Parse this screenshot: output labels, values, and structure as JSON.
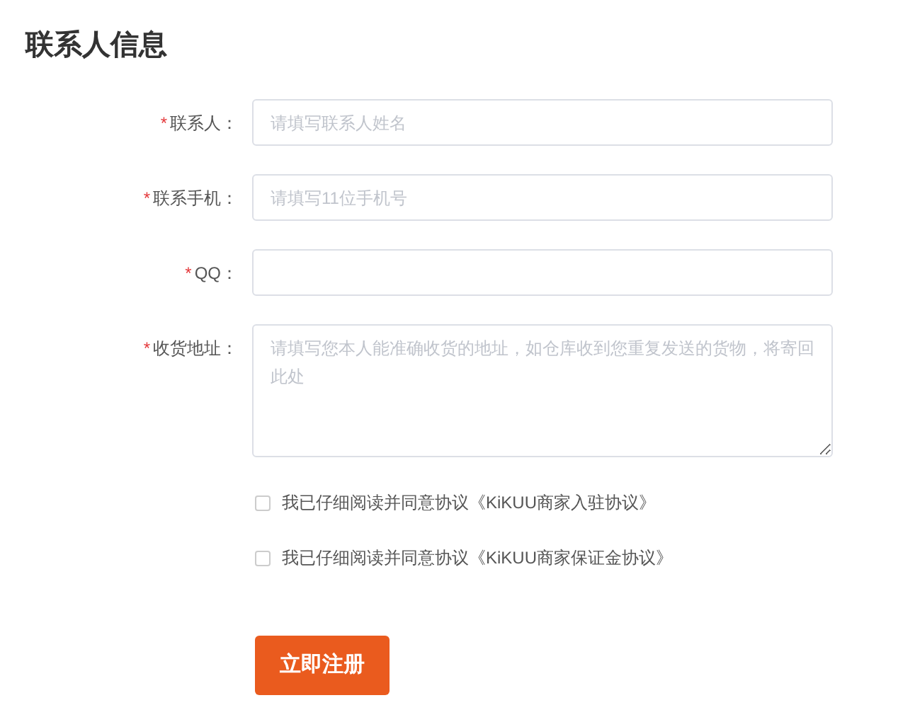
{
  "title": "联系人信息",
  "fields": [
    {
      "mark": "*",
      "label": "联系人：",
      "kind": "input",
      "placeholder": "请填写联系人姓名"
    },
    {
      "mark": "*",
      "label": "联系手机：",
      "kind": "input",
      "placeholder": "请填写11位手机号"
    },
    {
      "mark": "*",
      "label": "QQ：",
      "kind": "input"
    },
    {
      "mark": "*",
      "label": "收货地址：",
      "kind": "textarea",
      "placeholder": "请填写您本人能准确收货的地址，如仓库收到您重复发送的货物，将寄回此处"
    }
  ],
  "agreements": [
    {
      "label": "我已仔细阅读并同意协议《KiKUU商家入驻协议》",
      "checked": false
    },
    {
      "label": "我已仔细阅读并同意协议《KiKUU商家保证金协议》",
      "checked": false
    }
  ],
  "submit": "立即注册"
}
